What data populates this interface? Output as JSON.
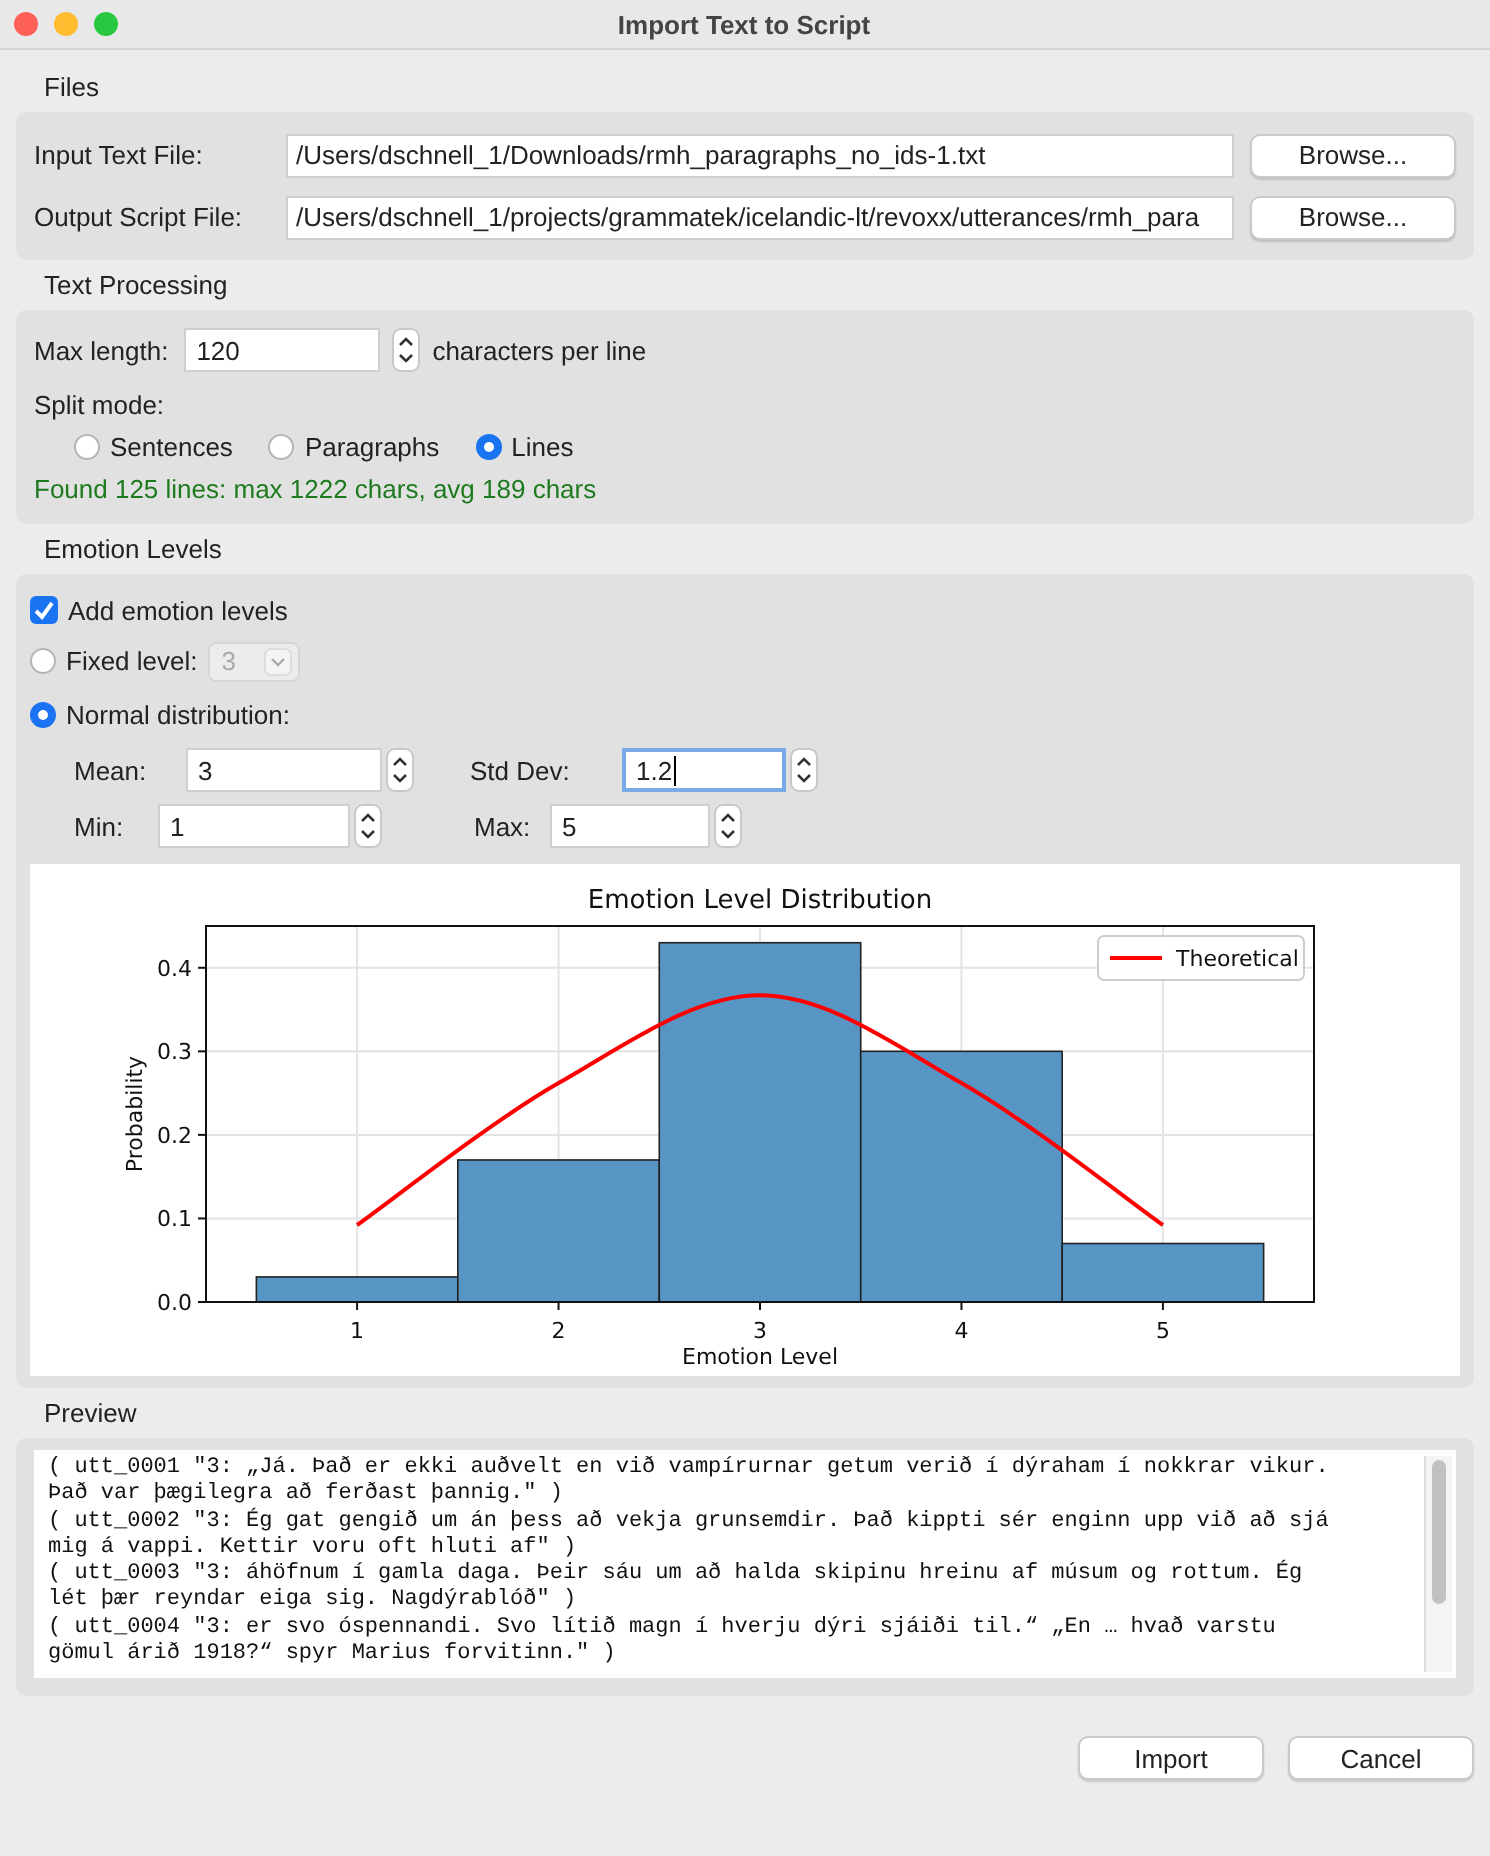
{
  "window": {
    "title": "Import Text to Script"
  },
  "files": {
    "title": "Files",
    "fields": [
      {
        "label": "Input Text File:",
        "value": "/Users/dschnell_1/Downloads/rmh_paragraphs_no_ids-1.txt",
        "button": "Browse..."
      },
      {
        "label": "Output Script File:",
        "value": "/Users/dschnell_1/projects/grammatek/icelandic-lt/revoxx/utterances/rmh_para",
        "button": "Browse..."
      }
    ]
  },
  "text_processing": {
    "title": "Text Processing",
    "max_length": {
      "label": "Max length:",
      "value": "120",
      "suffix": "characters per line"
    },
    "split_mode": {
      "label": "Split mode:",
      "options": [
        {
          "label": "Sentences",
          "selected": false
        },
        {
          "label": "Paragraphs",
          "selected": false
        },
        {
          "label": "Lines",
          "selected": true
        }
      ]
    },
    "status": "Found 125 lines: max 1222 chars, avg 189 chars"
  },
  "emotion_levels": {
    "title": "Emotion Levels",
    "add": {
      "label": "Add emotion levels",
      "checked": true
    },
    "modes": [
      {
        "kind": "dropdown",
        "label": "Fixed level:",
        "selected": false,
        "value": "3",
        "disabled": true
      },
      {
        "kind": "params",
        "label": "Normal distribution:",
        "selected": true,
        "params": [
          {
            "label": "Mean:",
            "value": "3",
            "focused": false
          },
          {
            "label": "Std Dev:",
            "value": "1.2",
            "focused": true
          },
          {
            "label": "Min:",
            "value": "1",
            "focused": false
          },
          {
            "label": "Max:",
            "value": "5",
            "focused": false
          }
        ]
      }
    ],
    "chart_data": {
      "type": "bar",
      "title": "Emotion Level Distribution",
      "xlabel": "Emotion Level",
      "ylabel": "Probability",
      "categories": [
        "1",
        "2",
        "3",
        "4",
        "5"
      ],
      "series": [
        {
          "color": "#5795c5",
          "values": [
            0.03,
            0.17,
            0.43,
            0.3,
            0.07
          ]
        },
        {
          "name": "Theoretical",
          "color": "#ff0000",
          "type": "line",
          "values": [
            0.092,
            0.262,
            0.367,
            0.262,
            0.092
          ]
        }
      ],
      "grid": true,
      "ylim": [
        0,
        0.45
      ],
      "yticks": [
        {
          "value": 0,
          "label": "0.0"
        },
        {
          "value": 0.1,
          "label": "0.1"
        },
        {
          "value": 0.2,
          "label": "0.2"
        },
        {
          "value": 0.3,
          "label": "0.3"
        },
        {
          "value": 0.4,
          "label": "0.4"
        }
      ]
    }
  },
  "preview": {
    "title": "Preview",
    "lines": [
      "( utt_0001 \"3: „Já. Það er ekki auðvelt en við vampírurnar getum verið í dýraham í nokkrar vikur.",
      "Það var þægilegra að ferðast þannig.\" )",
      "( utt_0002 \"3: Ég gat gengið um án þess að vekja grunsemdir. Það kippti sér enginn upp við að sjá",
      "mig á vappi. Kettir voru oft hluti af\" )",
      "( utt_0003 \"3: áhöfnum í gamla daga. Þeir sáu um að halda skipinu hreinu af músum og rottum. Ég",
      "lét þær reyndar eiga sig. Nagdýrablóð\" )",
      "( utt_0004 \"3: er svo óspennandi. Svo lítið magn í hverju dýri sjáiði til.“ „En … hvað varstu",
      "gömul árið 1918?“ spyr Marius forvitinn.\" )"
    ]
  },
  "buttons": [
    {
      "label": "Import"
    },
    {
      "label": "Cancel"
    }
  ]
}
